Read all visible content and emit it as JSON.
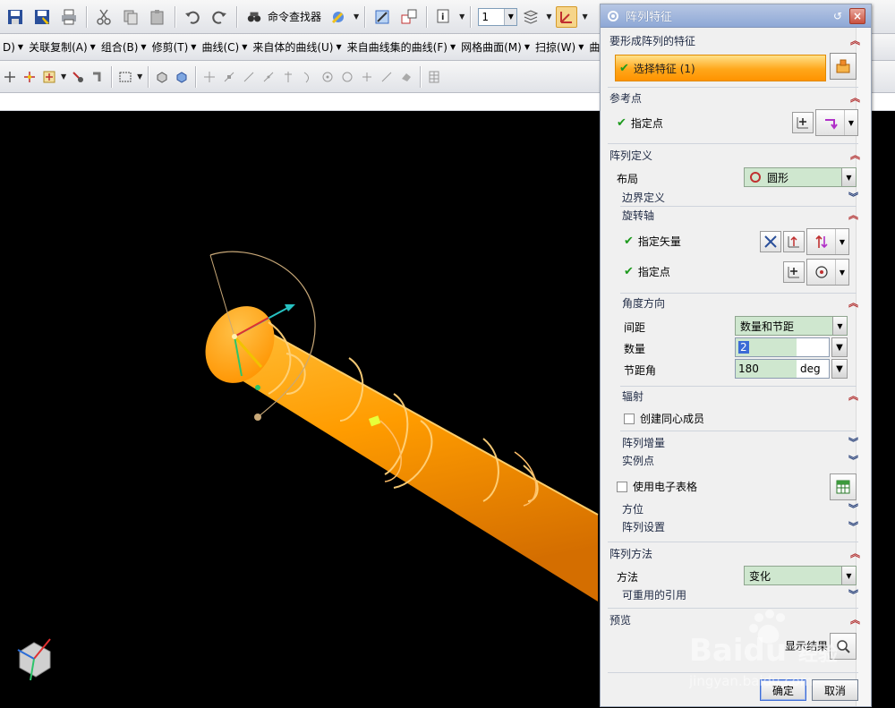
{
  "toolbar": {
    "command_finder_label": "命令查找器",
    "layer_value": "1"
  },
  "menubar": {
    "items": [
      {
        "label": "D)",
        "arrow": "▼"
      },
      {
        "label": "关联复制(A)",
        "arrow": "▼"
      },
      {
        "label": "组合(B)",
        "arrow": "▼"
      },
      {
        "label": "修剪(T)",
        "arrow": "▼"
      },
      {
        "label": "曲线(C)",
        "arrow": "▼"
      },
      {
        "label": "来自体的曲线(U)",
        "arrow": "▼"
      },
      {
        "label": "来自曲线集的曲线(F)",
        "arrow": "▼"
      },
      {
        "label": "网格曲面(M)",
        "arrow": "▼"
      },
      {
        "label": "扫掠(W)",
        "arrow": "▼"
      },
      {
        "label": "曲面(R",
        "arrow": ""
      }
    ]
  },
  "dialog": {
    "title": "阵列特征",
    "sections": {
      "features": {
        "title": "要形成阵列的特征",
        "select_label": "选择特征 (1)"
      },
      "reference_point": {
        "title": "参考点",
        "specify_point": "指定点"
      },
      "pattern_definition": {
        "title": "阵列定义",
        "layout_label": "布局",
        "layout_value": "圆形",
        "boundary_definition": "边界定义",
        "rotation_axis": {
          "title": "旋转轴",
          "specify_vector": "指定矢量",
          "specify_point": "指定点"
        },
        "angle_direction": {
          "title": "角度方向",
          "spacing_label": "间距",
          "spacing_value": "数量和节距",
          "count_label": "数量",
          "count_value": "2",
          "pitch_angle_label": "节距角",
          "pitch_angle_value": "180",
          "pitch_angle_unit": "deg"
        },
        "radiate": {
          "title": "辐射",
          "concentric_label": "创建同心成员"
        },
        "pattern_increment": "阵列增量",
        "instance_points": "实例点",
        "use_spreadsheet": "使用电子表格",
        "orientation": "方位",
        "pattern_settings": "阵列设置"
      },
      "pattern_method": {
        "title": "阵列方法",
        "method_label": "方法",
        "method_value": "变化",
        "reusable_references": "可重用的引用"
      },
      "preview": {
        "title": "预览",
        "show_result": "显示结果"
      }
    },
    "ok_label": "确定",
    "cancel_label": "取消"
  },
  "watermark": {
    "brand": "Baidu",
    "jingyan": "经验",
    "url": "jingyan.baidu.com"
  },
  "colors": {
    "viewport_bg": "#000000",
    "model_orange": "#ff9c00",
    "selection_orange": "#ffa71a",
    "field_green": "#cfe7cf",
    "check_green": "#1d9a1d",
    "expand_red": "#b23030"
  }
}
